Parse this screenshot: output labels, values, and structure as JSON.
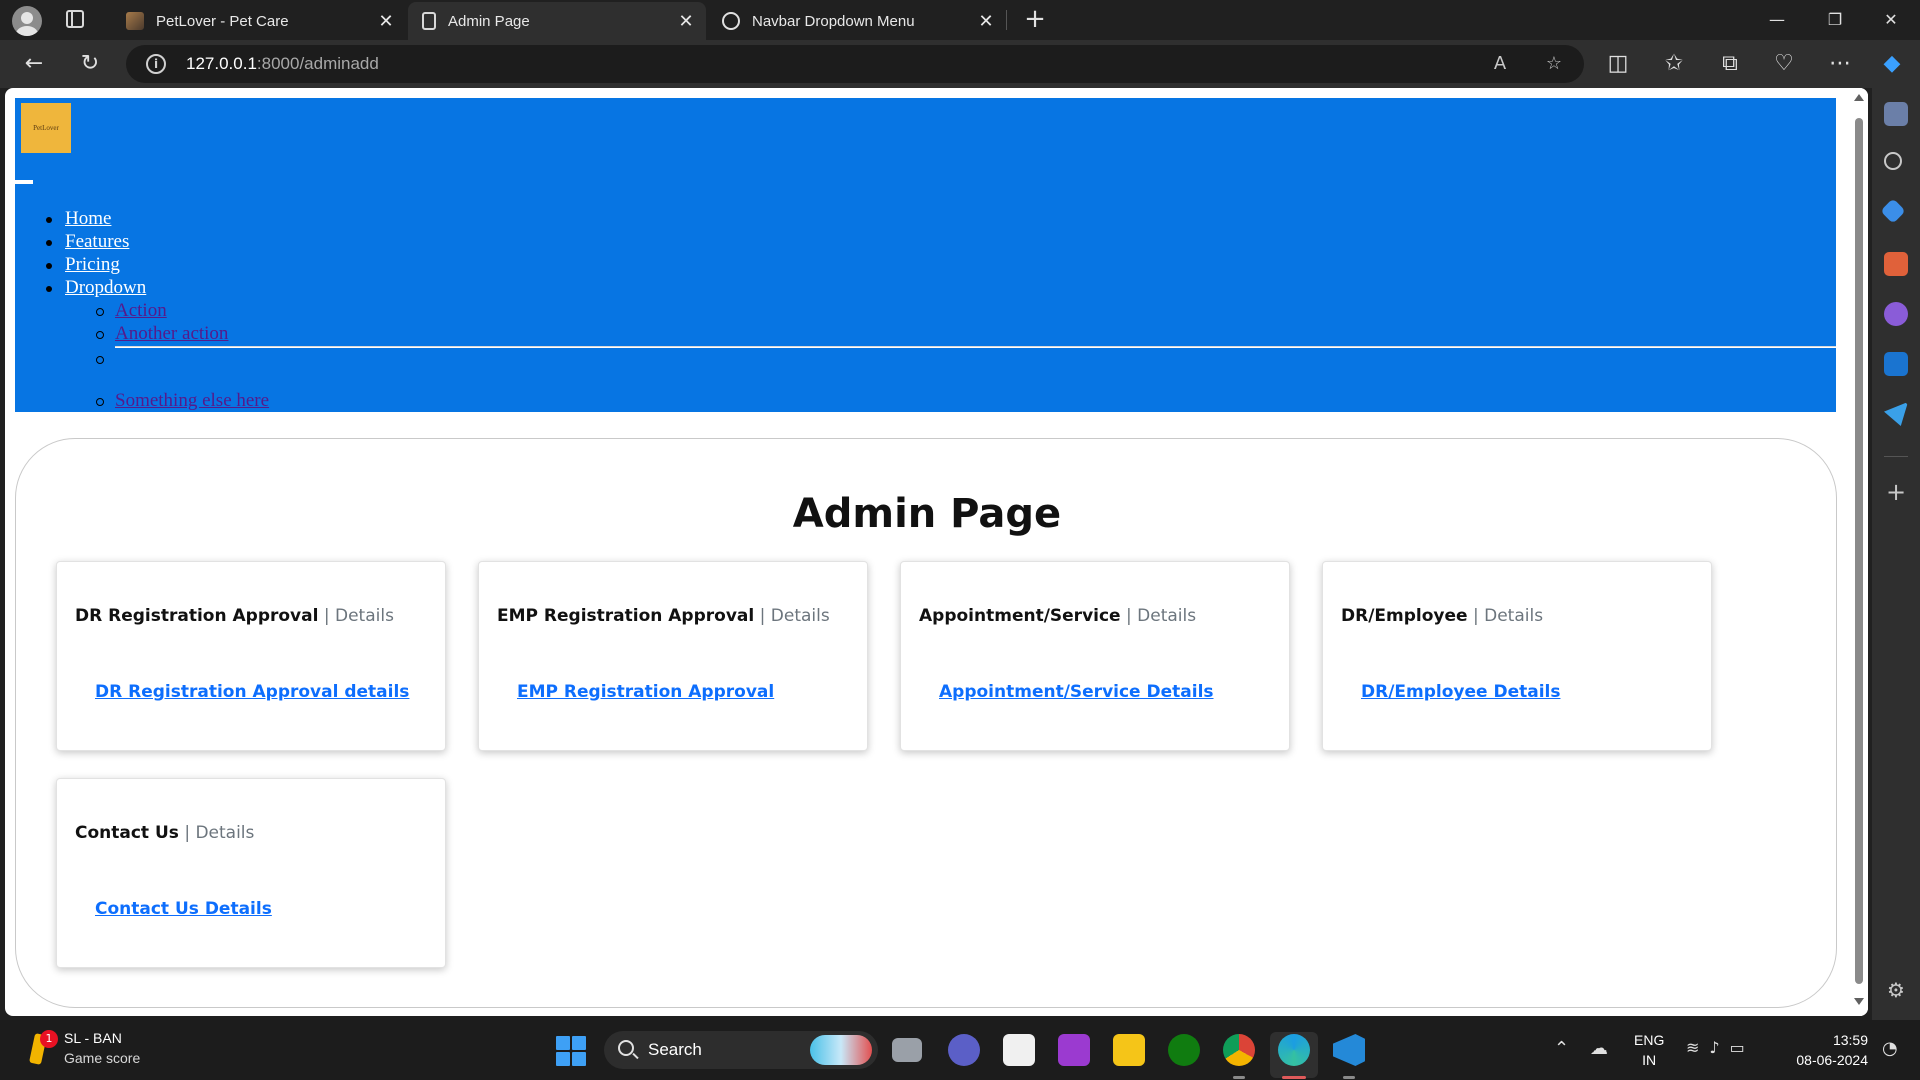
{
  "browser": {
    "tabs": [
      {
        "title": "PetLover - Pet Care",
        "active": false,
        "icon": "pet-favicon"
      },
      {
        "title": "Admin Page",
        "active": true,
        "icon": "page-icon"
      },
      {
        "title": "Navbar Dropdown Menu",
        "active": false,
        "icon": "chatgpt-icon"
      }
    ],
    "url_host": "127.0.0.1",
    "url_rest": ":8000/adminadd"
  },
  "site": {
    "brand": "PetLover",
    "nav": {
      "home": "Home",
      "features": "Features",
      "pricing": "Pricing",
      "dropdown": "Dropdown",
      "dropdown_items": {
        "action": "Action",
        "another": "Another action",
        "something": "Something else here"
      }
    }
  },
  "admin": {
    "title": "Admin Page",
    "separator": "|",
    "details_label": "Details",
    "cards": [
      {
        "heading": "DR Registration Approval",
        "link": "DR Registration Approval details"
      },
      {
        "heading": "EMP Registration Approval",
        "link": "EMP Registration Approval"
      },
      {
        "heading": "Appointment/Service",
        "link": "Appointment/Service Details"
      },
      {
        "heading": "DR/Employee",
        "link": "DR/Employee Details"
      },
      {
        "heading": "Contact Us",
        "link": "Contact Us Details"
      }
    ]
  },
  "taskbar": {
    "widget_badge": "1",
    "widget_title": "SL - BAN",
    "widget_subtitle": "Game score",
    "search_label": "Search",
    "lang_top": "ENG",
    "lang_bottom": "IN",
    "time": "13:59",
    "date": "08-06-2024"
  },
  "colors": {
    "navbar": "#0775e3",
    "link": "#0d6efd",
    "muted": "#6c757d",
    "logo": "#efb63c"
  }
}
